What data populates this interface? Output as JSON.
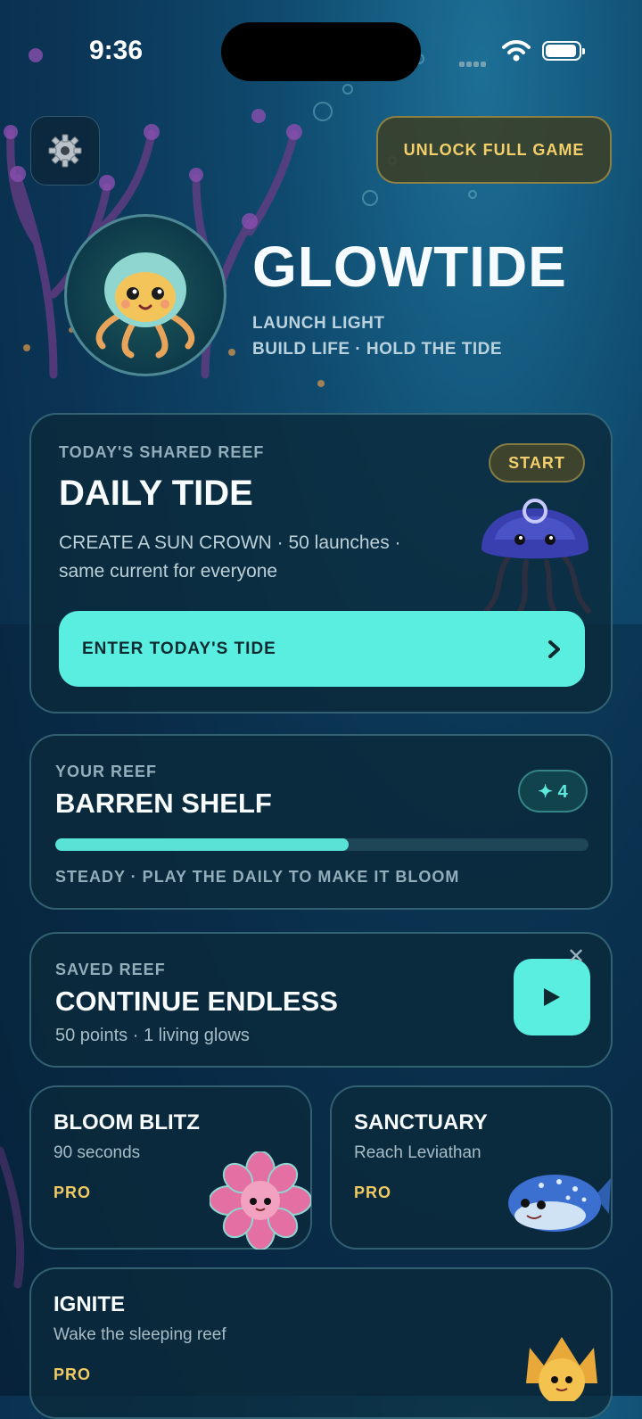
{
  "status_bar": {
    "time": "9:36"
  },
  "header": {
    "settings_icon": "gear-icon",
    "unlock_label": "UNLOCK FULL GAME",
    "title": "GLOWTIDE",
    "tagline_1": "LAUNCH LIGHT",
    "tagline_2": "BUILD LIFE · HOLD THE TIDE"
  },
  "daily": {
    "label": "TODAY'S SHARED REEF",
    "title": "DAILY TIDE",
    "start_label": "START",
    "desc_line_1": "CREATE A SUN CROWN · 50 launches ·",
    "desc_line_2": "same current for everyone",
    "cta_label": "ENTER TODAY'S TIDE",
    "cta_icon": "chevron-right-icon"
  },
  "reef": {
    "label": "YOUR REEF",
    "title": "BARREN SHELF",
    "gem_count": "✦ 4",
    "progress": 0.55,
    "status": "STEADY · PLAY THE DAILY TO MAKE IT BLOOM"
  },
  "saved": {
    "label": "SAVED REEF",
    "title": "CONTINUE ENDLESS",
    "detail": "50 points · 1 living glows",
    "play_icon": "play-icon",
    "close_icon": "close-icon"
  },
  "modes": [
    {
      "title": "BLOOM BLITZ",
      "subtitle": "90 seconds",
      "badge": "PRO"
    },
    {
      "title": "SANCTUARY",
      "subtitle": "Reach Leviathan",
      "badge": "PRO"
    },
    {
      "title": "IGNITE",
      "subtitle": "Wake the sleeping reef",
      "badge": "PRO"
    }
  ],
  "colors": {
    "accent": "#5aeee0",
    "gold": "#f1ca62",
    "card_bg": "#0b2a3a"
  }
}
